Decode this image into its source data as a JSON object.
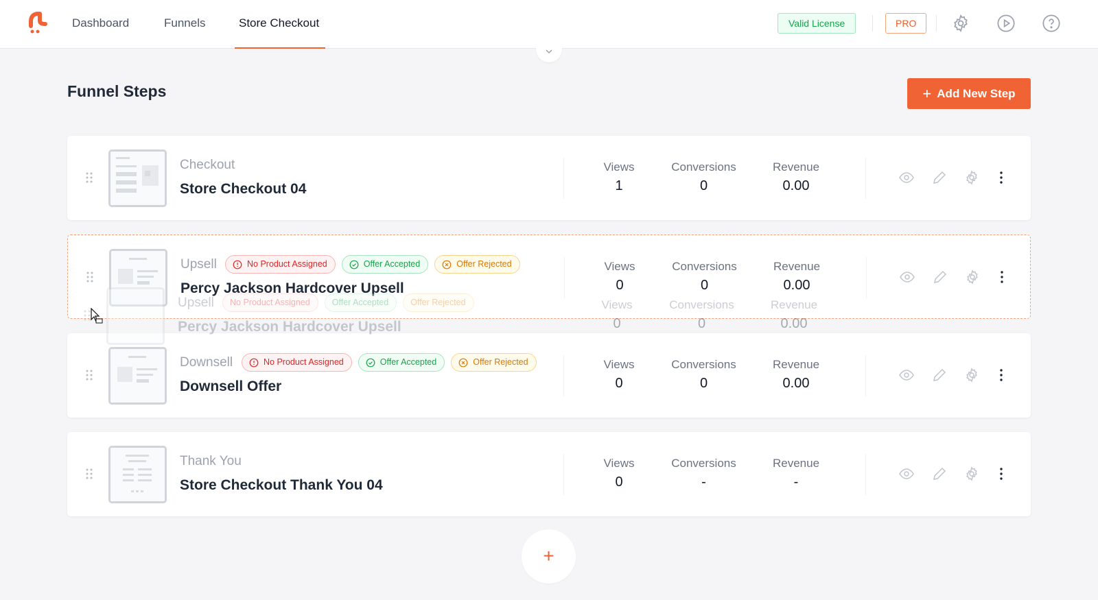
{
  "nav": {
    "items": [
      "Dashboard",
      "Funnels",
      "Store Checkout"
    ],
    "active": "Store Checkout",
    "license_badge": "Valid License",
    "pro_badge": "PRO",
    "icons": [
      "gear-icon",
      "play-icon",
      "help-icon"
    ]
  },
  "header": {
    "title": "Funnel Steps",
    "add_button": "Add New Step"
  },
  "labels": {
    "views": "Views",
    "conversions": "Conversions",
    "revenue": "Revenue"
  },
  "tags": {
    "no_product": "No Product Assigned",
    "accepted": "Offer Accepted",
    "rejected": "Offer Rejected"
  },
  "steps": [
    {
      "type": "Checkout",
      "title": "Store Checkout 04",
      "views": "1",
      "conversions": "0",
      "revenue": "0.00"
    },
    {
      "type": "Upsell",
      "title": "Percy Jackson Hardcover Upsell",
      "views": "0",
      "conversions": "0",
      "revenue": "0.00",
      "state": "dragging"
    },
    {
      "type": "Downsell",
      "title": "Downsell Offer",
      "views": "0",
      "conversions": "0",
      "revenue": "0.00"
    },
    {
      "type": "Thank You",
      "title": "Store Checkout Thank You 04",
      "views": "0",
      "conversions": "-",
      "revenue": "-"
    }
  ],
  "add_step_circle": "+",
  "colors": {
    "accent": "#f06335",
    "success": "#16a34a",
    "danger": "#dc2626",
    "warning": "#d97706"
  }
}
